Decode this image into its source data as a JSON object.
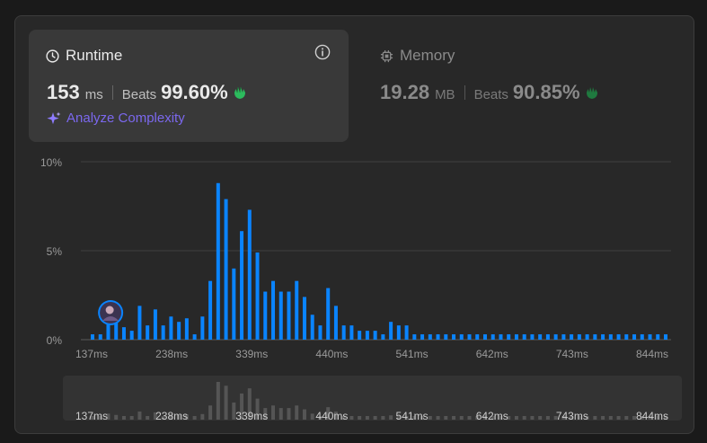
{
  "runtime": {
    "title": "Runtime",
    "value": "153",
    "unit": "ms",
    "beats_label": "Beats",
    "beats_value": "99.60%",
    "analyze_label": "Analyze Complexity"
  },
  "memory": {
    "title": "Memory",
    "value": "19.28",
    "unit": "MB",
    "beats_label": "Beats",
    "beats_value": "90.85%"
  },
  "icons": {
    "runtime": "clock-icon",
    "info": "info-icon",
    "memory": "chip-icon",
    "beats": "clapping-hands-icon",
    "analyze": "sparkle-icon",
    "marker": "user-avatar-icon"
  },
  "colors": {
    "bar": "#0a84ff",
    "mini_bar": "#555555",
    "beats_hand": "#2cbb5d",
    "analyze_text": "#7b68ee"
  },
  "chart_data": {
    "type": "bar",
    "title": "",
    "xlabel": "",
    "ylabel": "",
    "ylim": [
      0,
      10
    ],
    "y_ticks": [
      {
        "value": 0,
        "label": "0%"
      },
      {
        "value": 5,
        "label": "5%"
      },
      {
        "value": 10,
        "label": "10%"
      }
    ],
    "x_tick_labels": [
      "137ms",
      "238ms",
      "339ms",
      "440ms",
      "541ms",
      "642ms",
      "743ms",
      "844ms"
    ],
    "x_range_ms": [
      137,
      844
    ],
    "marker_ms": 153,
    "values": [
      0.3,
      0.3,
      1.4,
      1.1,
      0.7,
      0.5,
      1.9,
      0.8,
      1.7,
      0.8,
      1.3,
      1.0,
      1.2,
      0.3,
      1.3,
      3.3,
      8.8,
      7.9,
      4.0,
      6.1,
      7.3,
      4.9,
      2.7,
      3.3,
      2.7,
      2.7,
      3.3,
      2.4,
      1.4,
      0.8,
      2.9,
      1.9,
      0.8,
      0.8,
      0.5,
      0.5,
      0.5,
      0.3,
      1.0,
      0.8,
      0.8,
      0.3,
      0.3,
      0.3,
      0.3,
      0.3,
      0.3,
      0.3,
      0.3,
      0.3,
      0.3,
      0.3,
      0.3,
      0.3,
      0.3,
      0.3,
      0.3,
      0.3,
      0.3,
      0.3,
      0.3,
      0.3,
      0.3,
      0.3,
      0.3,
      0.3,
      0.3,
      0.3,
      0.3,
      0.3,
      0.3,
      0.3,
      0.3,
      0.3
    ]
  }
}
